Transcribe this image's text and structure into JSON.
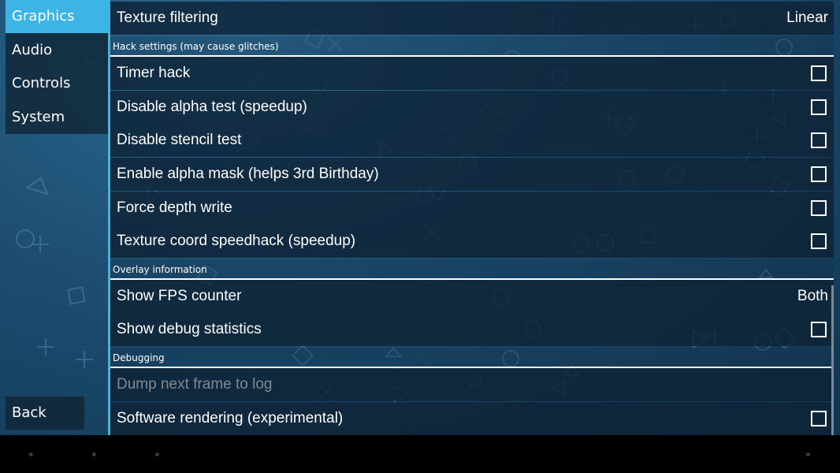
{
  "tabs": [
    {
      "label": "Graphics",
      "active": true
    },
    {
      "label": "Audio",
      "active": false
    },
    {
      "label": "Controls",
      "active": false
    },
    {
      "label": "System",
      "active": false
    }
  ],
  "back_label": "Back",
  "rows": {
    "texture_filtering": {
      "label": "Texture filtering",
      "value": "Linear"
    },
    "timer_hack": {
      "label": "Timer hack",
      "checked": false
    },
    "disable_alpha_test": {
      "label": "Disable alpha test (speedup)",
      "checked": false
    },
    "disable_stencil_test": {
      "label": "Disable stencil test",
      "checked": false
    },
    "enable_alpha_mask": {
      "label": "Enable alpha mask (helps 3rd Birthday)",
      "checked": false
    },
    "force_depth_write": {
      "label": "Force depth write",
      "checked": false
    },
    "texture_coord_speedhack": {
      "label": "Texture coord speedhack (speedup)",
      "checked": false
    },
    "show_fps_counter": {
      "label": "Show FPS counter",
      "value": "Both"
    },
    "show_debug_statistics": {
      "label": "Show debug statistics",
      "checked": false
    },
    "dump_next_frame": {
      "label": "Dump next frame to log",
      "enabled": false
    },
    "software_rendering": {
      "label": "Software rendering (experimental)",
      "checked": false
    }
  },
  "headers": {
    "hack_settings": "Hack settings (may cause glitches)",
    "overlay_information": "Overlay information",
    "debugging": "Debugging"
  },
  "colors": {
    "accent": "#3cb4e6",
    "row_background": "#0e2234",
    "background_top": "#2d6c95",
    "background_bottom": "#103551"
  }
}
